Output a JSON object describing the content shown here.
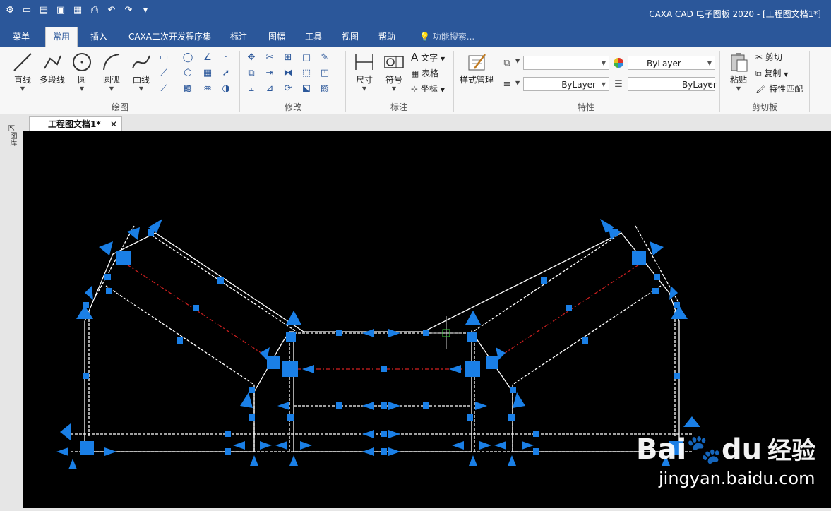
{
  "app": {
    "title": "CAXA CAD 电子图板 2020 - [工程图文档1*]"
  },
  "menu_tabs": [
    "菜单",
    "常用",
    "插入",
    "CAXA二次开发程序集",
    "标注",
    "图幅",
    "工具",
    "视图",
    "帮助"
  ],
  "search_placeholder": "功能搜索...",
  "ribbon": {
    "draw": {
      "label": "绘图",
      "line": "直线",
      "polyline": "多段线",
      "circle": "圆",
      "arc": "圆弧",
      "curve": "曲线"
    },
    "modify": {
      "label": "修改"
    },
    "annotate": {
      "label": "标注",
      "dimension": "尺寸",
      "symbol": "符号",
      "text": "文字",
      "table": "表格",
      "coordinate": "坐标"
    },
    "style": {
      "style_manager": "样式管理"
    },
    "properties": {
      "label": "特性",
      "layer_value": "",
      "color_value": "ByLayer",
      "linetype_value": "ByLayer",
      "lineweight_value": "ByLayer"
    },
    "clipboard": {
      "label": "剪切板",
      "paste": "粘贴",
      "cut": "剪切",
      "copy": "复制",
      "match": "特性匹配"
    }
  },
  "left_panel_label": "图库",
  "doc_tab": {
    "label": "工程图文档1*",
    "close": "✕"
  },
  "watermark": {
    "brand_a": "Bai",
    "brand_b": "du",
    "brand_c": "经验",
    "url": "jingyan.baidu.com"
  },
  "colors": {
    "titlebar": "#2b579a",
    "canvas": "#000000",
    "grip": "#1a7fe6",
    "line": "#ffffff",
    "center_line": "#d22020"
  }
}
